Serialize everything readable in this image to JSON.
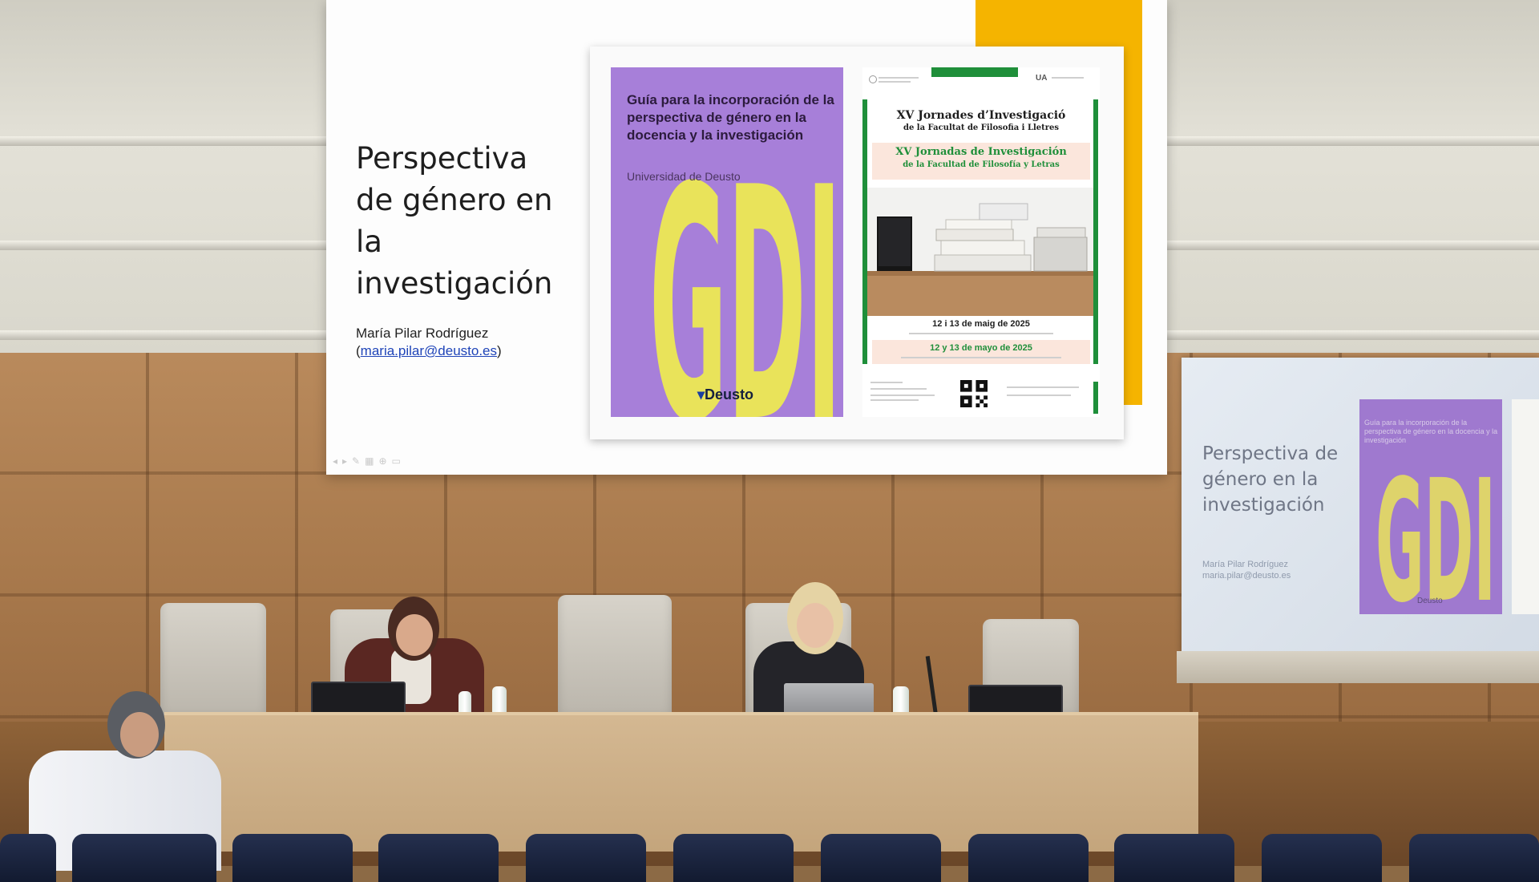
{
  "slide": {
    "title": "Perspectiva de género en la investigación",
    "author": "María Pilar Rodríguez",
    "email": "maria.pilar@deusto.es",
    "email_prefix": "(",
    "email_suffix": ")"
  },
  "book_cover": {
    "title": "Guía para la incorporación de la perspectiva de género en la docencia y la investigación",
    "subtitle": "Universidad de Deusto",
    "letters": "GDI",
    "brand": "Deusto"
  },
  "poster": {
    "header_right": "UA",
    "title_ca": "XV Jornades d’Investigació",
    "subtitle_ca": "de la Facultat de Filosofia i Lletres",
    "title_es": "XV Jornadas de Investigación",
    "subtitle_es": "de la Facultad de Filosofía y Letras",
    "dates_ca": "12 i 13 de maig de 2025",
    "dates_es": "12 y 13 de mayo de 2025"
  },
  "side_screen": {
    "title": "Perspectiva de género en la investigación",
    "cover_letters": "GDI",
    "cover_brand": "Deusto"
  },
  "colors": {
    "slide_background": "#fdfdfd",
    "accent_yellow": "#f5b400",
    "cover_purple": "#a77fd9",
    "cover_yellow": "#e9e35a",
    "poster_green": "#1f8f3a",
    "link_blue": "#1f44b8",
    "wall_wood": "#b98a5c",
    "seat_navy": "#1b2440"
  }
}
